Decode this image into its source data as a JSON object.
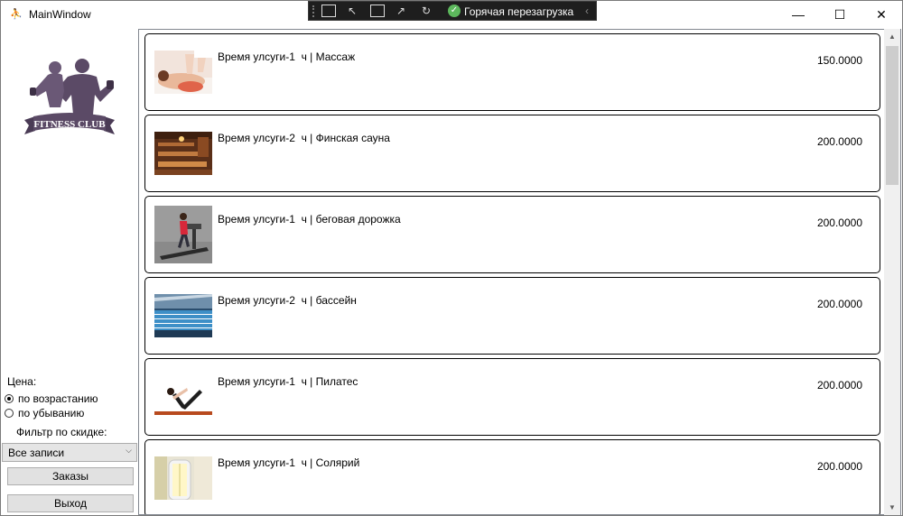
{
  "window": {
    "title": "MainWindow",
    "app_icon": "fitness-app-icon",
    "minimize_glyph": "—",
    "maximize_glyph": "☐",
    "close_glyph": "✕"
  },
  "devbar": {
    "hot_reload_label": "Горячая перезагрузка",
    "hot_reload_status_color": "#5cb85c"
  },
  "sidebar": {
    "logo_text": "FITNESS CLUB",
    "price_label": "Цена:",
    "sort_options": [
      {
        "label": "по возрастанию",
        "checked": true
      },
      {
        "label": "по убыванию",
        "checked": false
      }
    ],
    "filter_label": "Фильтр по скидке:",
    "filter_value": "Все записи",
    "orders_button": "Заказы",
    "exit_button": "Выход"
  },
  "services": [
    {
      "title": "Время улсуги-1  ч | Массаж",
      "price": "150.0000",
      "image": "massage-photo"
    },
    {
      "title": "Время улсуги-2  ч | Финская сауна",
      "price": "200.0000",
      "image": "sauna-photo"
    },
    {
      "title": "Время улсуги-1  ч | беговая дорожка",
      "price": "200.0000",
      "image": "treadmill-photo"
    },
    {
      "title": "Время улсуги-2  ч | бассейн",
      "price": "200.0000",
      "image": "pool-photo"
    },
    {
      "title": "Время улсуги-1  ч | Пилатес",
      "price": "200.0000",
      "image": "pilates-photo"
    },
    {
      "title": "Время улсуги-1  ч | Солярий",
      "price": "200.0000",
      "image": "solarium-photo"
    }
  ],
  "colors": {
    "logo": "#5b4a66",
    "card_border": "#000000",
    "button_bg": "#e1e1e1"
  }
}
